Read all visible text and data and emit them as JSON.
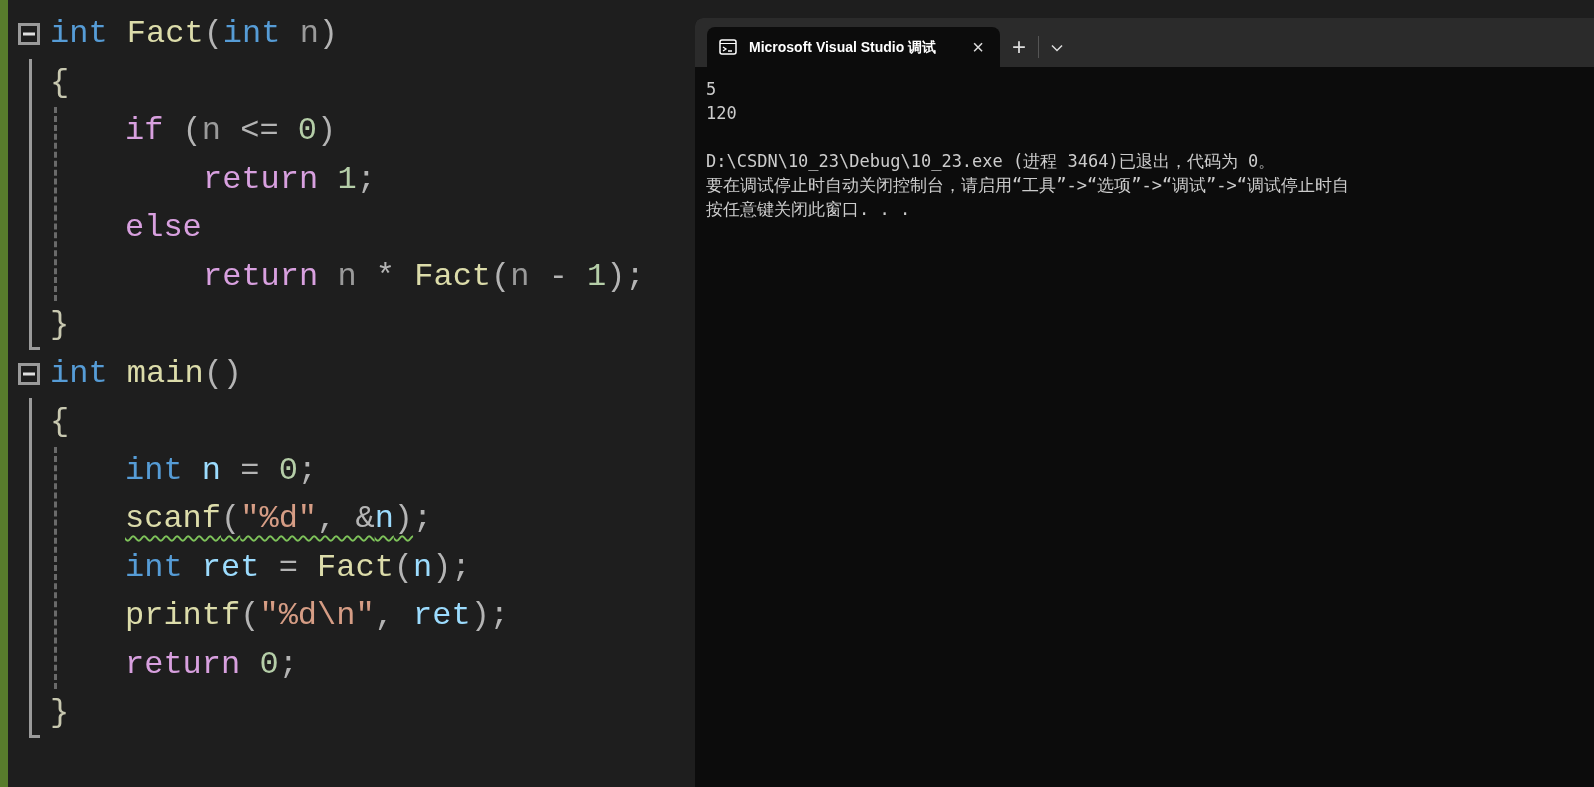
{
  "editor": {
    "functions": [
      {
        "expanded": true,
        "header": [
          {
            "text": "int",
            "kind": "keyword"
          },
          {
            "text": " Fact",
            "kind": "function"
          },
          {
            "text": "(",
            "kind": "punct"
          },
          {
            "text": "int",
            "kind": "keyword"
          },
          {
            "text": " n",
            "kind": "parameter"
          },
          {
            "text": ")",
            "kind": "punct"
          }
        ],
        "open": "{",
        "close": "}",
        "body": [
          {
            "tokens": [
              {
                "text": "if",
                "kind": "control"
              },
              {
                "text": " (",
                "kind": "punct"
              },
              {
                "text": "n",
                "kind": "parameter"
              },
              {
                "text": " <= ",
                "kind": "punct"
              },
              {
                "text": "0",
                "kind": "number"
              },
              {
                "text": ")",
                "kind": "punct"
              }
            ],
            "children": [
              {
                "tokens": [
                  {
                    "text": "return",
                    "kind": "control"
                  },
                  {
                    "text": " 1",
                    "kind": "number"
                  },
                  {
                    "text": ";",
                    "kind": "punct"
                  }
                ]
              }
            ]
          },
          {
            "tokens": [
              {
                "text": "else",
                "kind": "control"
              }
            ],
            "children": [
              {
                "tokens": [
                  {
                    "text": "return",
                    "kind": "control"
                  },
                  {
                    "text": " n",
                    "kind": "parameter"
                  },
                  {
                    "text": " * ",
                    "kind": "punct"
                  },
                  {
                    "text": "Fact",
                    "kind": "function"
                  },
                  {
                    "text": "(",
                    "kind": "punct"
                  },
                  {
                    "text": "n",
                    "kind": "parameter"
                  },
                  {
                    "text": " - ",
                    "kind": "punct"
                  },
                  {
                    "text": "1",
                    "kind": "number"
                  },
                  {
                    "text": ");",
                    "kind": "punct"
                  }
                ]
              }
            ]
          }
        ]
      },
      {
        "expanded": true,
        "header": [
          {
            "text": "int",
            "kind": "keyword"
          },
          {
            "text": " main",
            "kind": "function"
          },
          {
            "text": "()",
            "kind": "punct"
          }
        ],
        "open": "{",
        "close": "}",
        "body": [
          {
            "tokens": [
              {
                "text": "int",
                "kind": "keyword"
              },
              {
                "text": " n",
                "kind": "local"
              },
              {
                "text": " = ",
                "kind": "punct"
              },
              {
                "text": "0",
                "kind": "number"
              },
              {
                "text": ";",
                "kind": "punct"
              }
            ]
          },
          {
            "tokens": [
              {
                "text": "scanf",
                "kind": "function",
                "warning": true
              },
              {
                "text": "(",
                "kind": "punct",
                "warning": true
              },
              {
                "text": "\"%d\"",
                "kind": "string",
                "warning": true
              },
              {
                "text": ", &",
                "kind": "punct",
                "warning": true
              },
              {
                "text": "n",
                "kind": "local",
                "warning": true
              },
              {
                "text": ")",
                "kind": "punct",
                "warning": true
              },
              {
                "text": ";",
                "kind": "punct",
                "warning": false
              }
            ]
          },
          {
            "tokens": [
              {
                "text": "int",
                "kind": "keyword"
              },
              {
                "text": " ret",
                "kind": "local"
              },
              {
                "text": " = ",
                "kind": "punct"
              },
              {
                "text": "Fact",
                "kind": "function"
              },
              {
                "text": "(",
                "kind": "punct"
              },
              {
                "text": "n",
                "kind": "local"
              },
              {
                "text": ");",
                "kind": "punct"
              }
            ]
          },
          {
            "tokens": [
              {
                "text": "printf",
                "kind": "function"
              },
              {
                "text": "(",
                "kind": "punct"
              },
              {
                "text": "\"%d\\n\"",
                "kind": "string"
              },
              {
                "text": ", ",
                "kind": "punct"
              },
              {
                "text": "ret",
                "kind": "local"
              },
              {
                "text": ");",
                "kind": "punct"
              }
            ]
          },
          {
            "tokens": [
              {
                "text": "return",
                "kind": "control"
              },
              {
                "text": " 0",
                "kind": "number"
              },
              {
                "text": ";",
                "kind": "punct"
              }
            ]
          }
        ]
      }
    ]
  },
  "terminal": {
    "tab": {
      "title": "Microsoft Visual Studio 调试",
      "selected": true,
      "close": "×"
    },
    "new_tab": "+",
    "output": [
      [
        "5",
        "120"
      ],
      [
        "D:\\CSDN\\10_23\\Debug\\10_23.exe (进程 3464)已退出，代码为 0。",
        "要在调试停止时自动关闭控制台，请启用“工具”->“选项”->“调试”->“调试停止时自",
        "按任意键关闭此窗口. . ."
      ]
    ]
  }
}
